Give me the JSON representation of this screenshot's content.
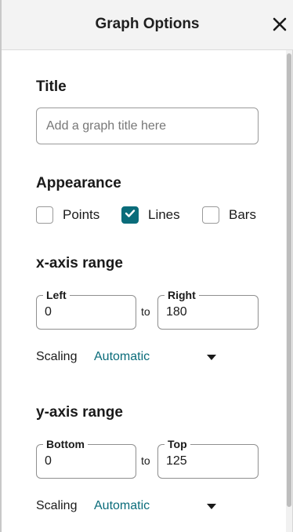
{
  "header": {
    "title": "Graph Options",
    "close_icon": "close-icon"
  },
  "title_section": {
    "heading": "Title",
    "placeholder": "Add a graph title here",
    "value": ""
  },
  "appearance": {
    "heading": "Appearance",
    "options": [
      {
        "label": "Points",
        "checked": false
      },
      {
        "label": "Lines",
        "checked": true
      },
      {
        "label": "Bars",
        "checked": false
      }
    ]
  },
  "x_axis": {
    "heading": "x-axis range",
    "left_label": "Left",
    "left_value": "0",
    "to_label": "to",
    "right_label": "Right",
    "right_value": "180",
    "scaling_label": "Scaling",
    "scaling_value": "Automatic"
  },
  "y_axis": {
    "heading": "y-axis range",
    "bottom_label": "Bottom",
    "bottom_value": "0",
    "to_label": "to",
    "top_label": "Top",
    "top_value": "125",
    "scaling_label": "Scaling",
    "scaling_value": "Automatic"
  },
  "colors": {
    "accent": "#0a6c7a",
    "header_bg": "#f3f3f3",
    "border": "#9a9a9a"
  }
}
